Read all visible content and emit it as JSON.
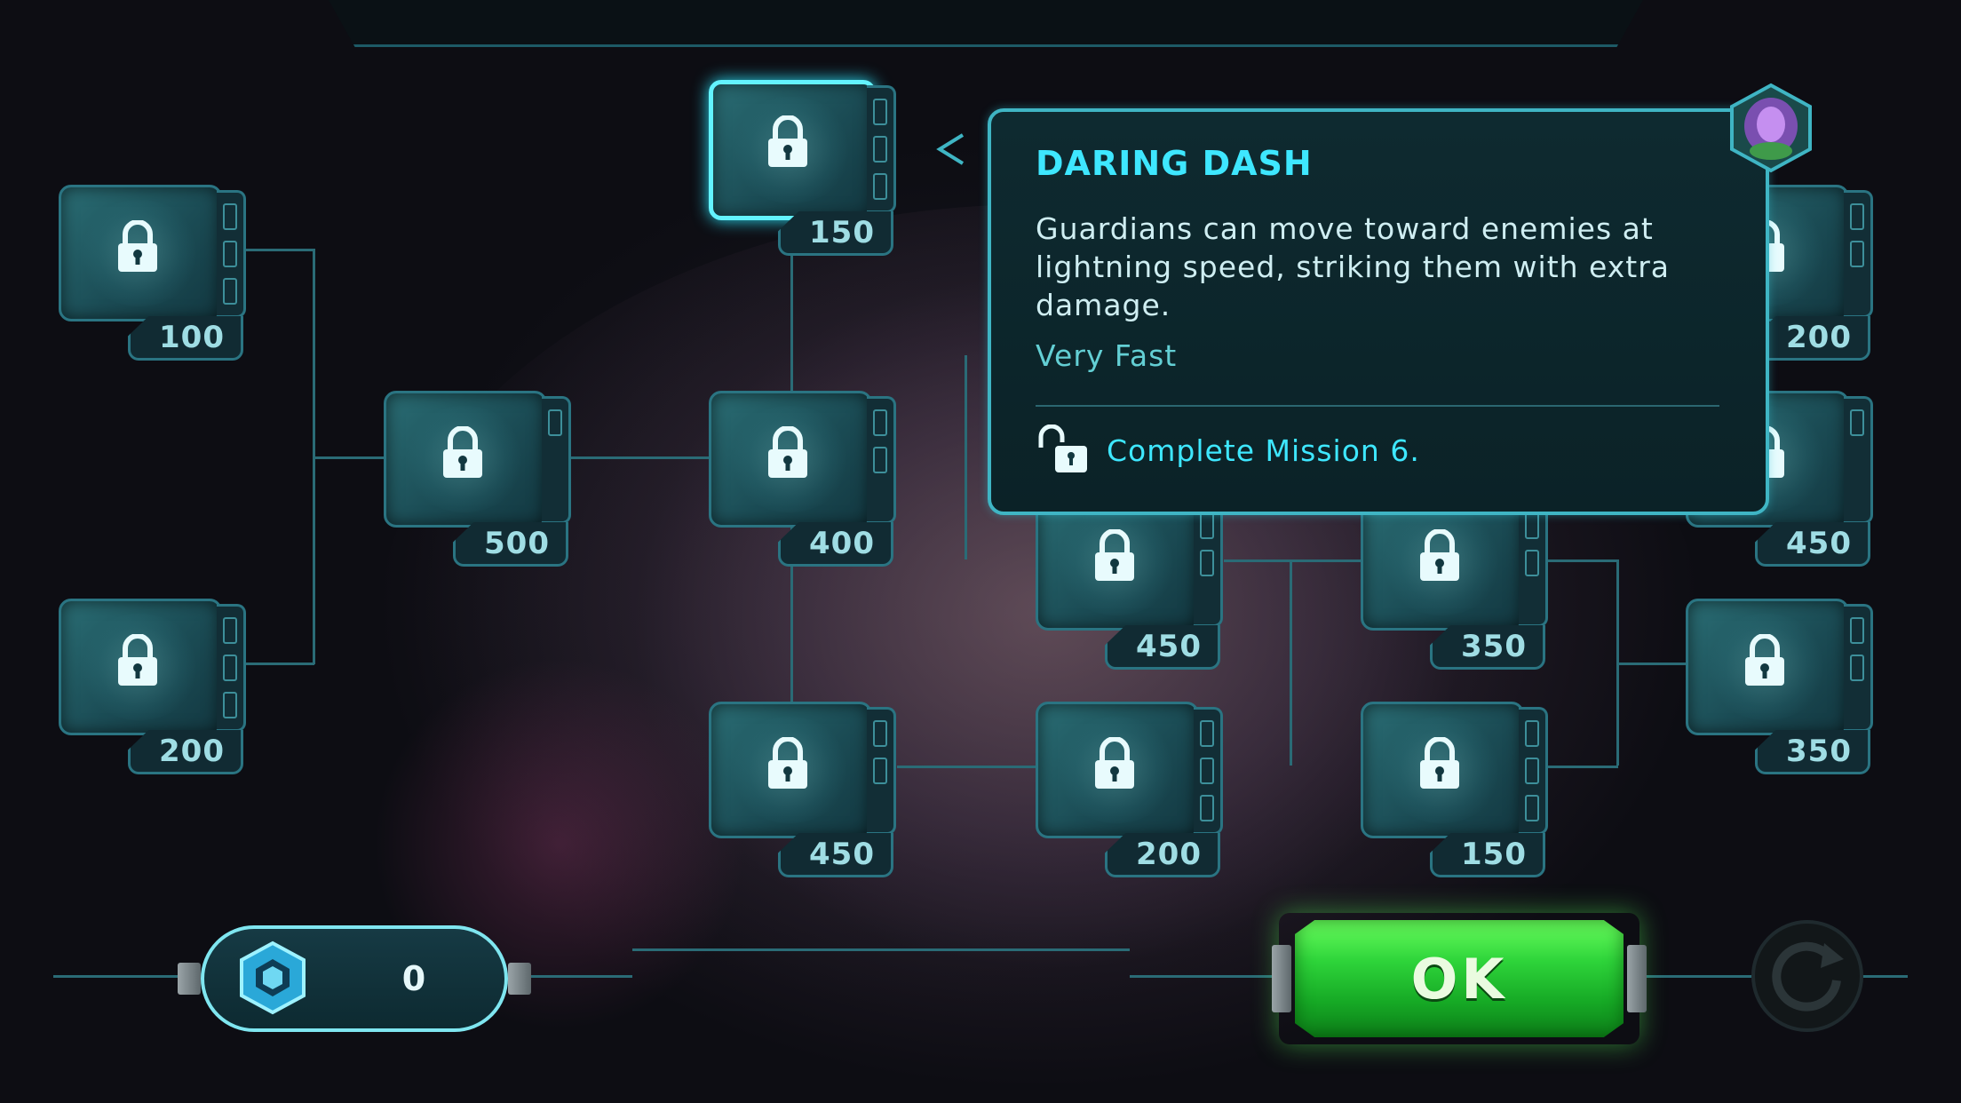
{
  "skill_tree": {
    "nodes": [
      {
        "name": "node-1",
        "cost": "100"
      },
      {
        "name": "node-2",
        "cost": "200"
      },
      {
        "name": "node-3",
        "cost": "500"
      },
      {
        "name": "node-4",
        "cost": "150",
        "selected": true
      },
      {
        "name": "node-5",
        "cost": "400"
      },
      {
        "name": "node-6",
        "cost": "450"
      },
      {
        "name": "node-7",
        "cost": "450"
      },
      {
        "name": "node-8",
        "cost": "200"
      },
      {
        "name": "node-9",
        "cost": "350"
      },
      {
        "name": "node-10",
        "cost": "150"
      },
      {
        "name": "node-11",
        "cost": "200"
      },
      {
        "name": "node-12",
        "cost": "450"
      },
      {
        "name": "node-13",
        "cost": "350"
      }
    ]
  },
  "tooltip": {
    "title": "DARING DASH",
    "description": "Guardians can move toward enemies at lightning speed, striking them with extra damage.",
    "speed": "Very Fast",
    "unlock_requirement": "Complete Mission 6."
  },
  "currency": {
    "icon": "hex-gem-icon",
    "value": "0"
  },
  "buttons": {
    "ok_label": "OK",
    "reset_icon": "reset-icon"
  },
  "colors": {
    "accent": "#3ee7ff",
    "tile": "#1b4c55",
    "ok_green": "#2ed43a"
  }
}
